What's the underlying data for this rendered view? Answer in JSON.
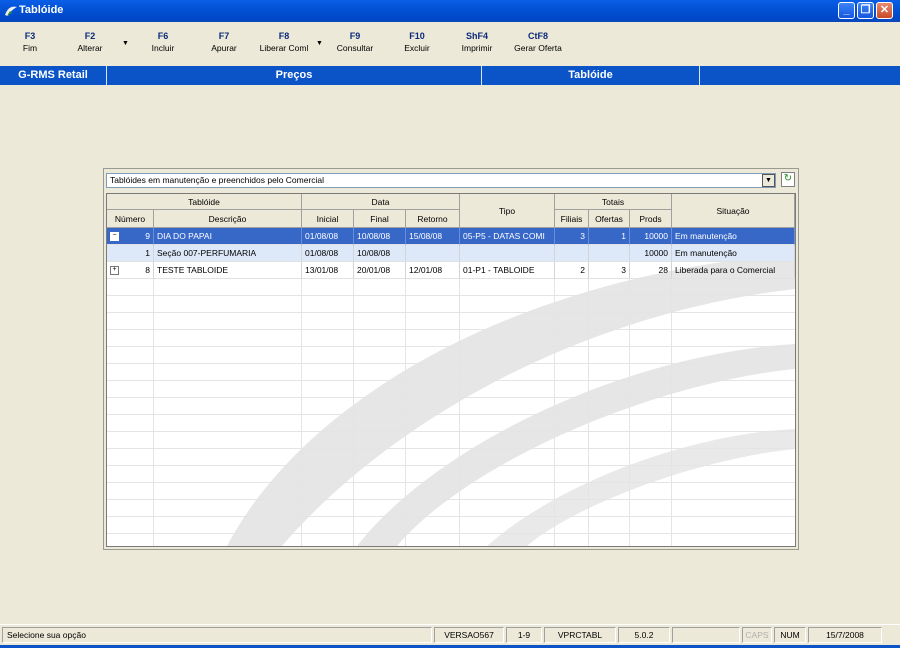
{
  "window": {
    "title": "Tablóide",
    "controls": {
      "minimize": "_",
      "restore": "❐",
      "close": "✕"
    }
  },
  "toolbar": [
    {
      "key": "F3",
      "label": "Fim"
    },
    {
      "key": "F2",
      "label": "Alterar",
      "dropdown": true
    },
    {
      "key": "F6",
      "label": "Incluir"
    },
    {
      "key": "F7",
      "label": "Apurar"
    },
    {
      "key": "F8",
      "label": "Liberar Coml",
      "dropdown": true
    },
    {
      "key": "F9",
      "label": "Consultar"
    },
    {
      "key": "F10",
      "label": "Excluir"
    },
    {
      "key": "ShF4",
      "label": "Imprimir"
    },
    {
      "key": "CtF8",
      "label": "Gerar Oferta"
    }
  ],
  "modules": {
    "system": "G-RMS Retail",
    "module": "Preços",
    "screen": "Tablóide"
  },
  "filter": {
    "selected": "Tablóides em manutenção e preenchidos pelo Comercial"
  },
  "grid": {
    "header_groups": {
      "tabloide": "Tablóide",
      "data": "Data",
      "tipo": "Tipo",
      "totais": "Totais",
      "situacao": "Situação"
    },
    "columns": {
      "numero": "Número",
      "descricao": "Descrição",
      "inicial": "Inicial",
      "final": "Final",
      "retorno": "Retorno",
      "filiais": "Filiais",
      "ofertas": "Ofertas",
      "prods": "Prods"
    },
    "rows": [
      {
        "expander": "−",
        "numero": "9",
        "descricao": "DIA DO PAPAI",
        "inicial": "01/08/08",
        "final": "10/08/08",
        "retorno": "15/08/08",
        "tipo": "05-P5 - DATAS COMI",
        "filiais": "3",
        "ofertas": "1",
        "prods": "10000",
        "situacao": "Em manutenção"
      },
      {
        "expander": "",
        "numero": "1",
        "descricao": "Seção 007-PERFUMARIA",
        "inicial": "01/08/08",
        "final": "10/08/08",
        "retorno": "",
        "tipo": "",
        "filiais": "",
        "ofertas": "",
        "prods": "10000",
        "situacao": "Em manutenção"
      },
      {
        "expander": "+",
        "numero": "8",
        "descricao": "TESTE TABLOIDE",
        "inicial": "13/01/08",
        "final": "20/01/08",
        "retorno": "12/01/08",
        "tipo": "01-P1 - TABLOIDE",
        "filiais": "2",
        "ofertas": "3",
        "prods": "28",
        "situacao": "Liberada para o Comercial"
      }
    ]
  },
  "status": {
    "message": "Selecione sua opção",
    "version": "VERSAO567",
    "range": "1-9",
    "program": "VPRCTABL",
    "release": "5.0.2",
    "caps": "CAPS",
    "num": "NUM",
    "date": "15/7/2008"
  },
  "colors": {
    "titlebar": "#0352d6",
    "module_bar": "#0a54c8",
    "selected_row": "#3768c8",
    "sub_row": "#dde9f9",
    "background": "#ece9d8"
  }
}
